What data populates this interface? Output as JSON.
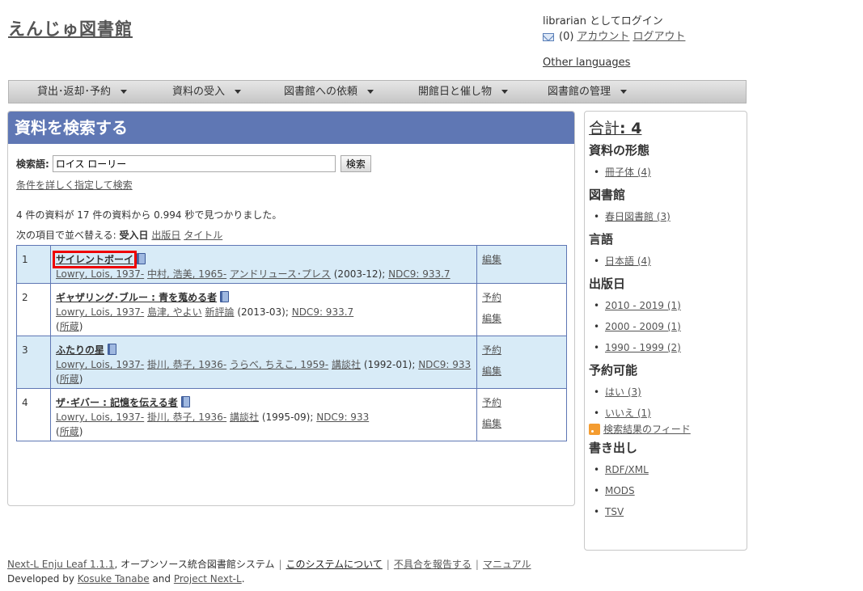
{
  "site": {
    "title": "えんじゅ図書館"
  },
  "user": {
    "login_text": "librarian としてログイン",
    "message_count": "(0)",
    "account_label": "アカウント",
    "logout_label": "ログアウト",
    "other_languages": "Other languages"
  },
  "nav": [
    {
      "label": "貸出･返却･予約"
    },
    {
      "label": "資料の受入"
    },
    {
      "label": "図書館への依頼"
    },
    {
      "label": "開館日と催し物"
    },
    {
      "label": "図書館の管理"
    }
  ],
  "main": {
    "heading": "資料を検索する",
    "search_label": "検索語:",
    "search_value": "ロイス ローリー",
    "search_button": "検索",
    "advanced_link": "条件を詳しく指定して検索",
    "summary": "4 件の資料が 17 件の資料から 0.994 秒で見つかりました。",
    "sort_label": "次の項目で並べ替える:",
    "sort_current": "受入日",
    "sort_pubdate": "出版日",
    "sort_title": "タイトル"
  },
  "results": [
    {
      "no": "1",
      "title": "サイレントボーイ",
      "author": "Lowry, Lois, 1937-",
      "others": [
        "中村, 浩美, 1965-"
      ],
      "publisher": "アンドリュース･プレス",
      "date": "(2003-12)",
      "ndc": "NDC9: 933.7",
      "holding": "",
      "actions": [
        "編集"
      ]
    },
    {
      "no": "2",
      "title": "ギャザリング･ブルー : 青を蒐める者",
      "author": "Lowry, Lois, 1937-",
      "others": [
        "島津, やよい"
      ],
      "publisher": "新評論",
      "date": "(2013-03)",
      "ndc": "NDC9: 933.7",
      "holding": "所蔵",
      "actions": [
        "予約",
        "編集"
      ]
    },
    {
      "no": "3",
      "title": "ふたりの星",
      "author": "Lowry, Lois, 1937-",
      "others": [
        "掛川, 恭子, 1936-",
        "うらべ, ちえこ, 1959-"
      ],
      "publisher": "講談社",
      "date": "(1992-01)",
      "ndc": "NDC9: 933",
      "holding": "所蔵",
      "actions": [
        "予約",
        "編集"
      ]
    },
    {
      "no": "4",
      "title": "ザ･ギバー : 記憶を伝える者",
      "author": "Lowry, Lois, 1937-",
      "others": [
        "掛川, 恭子, 1936-"
      ],
      "publisher": "講談社",
      "date": "(1995-09)",
      "ndc": "NDC9: 933",
      "holding": "所蔵",
      "actions": [
        "予約",
        "編集"
      ]
    }
  ],
  "side": {
    "total_label": "合計",
    "total_value": ": 4",
    "facets": [
      {
        "heading": "資料の形態",
        "items": [
          "冊子体 (4)"
        ]
      },
      {
        "heading": "図書館",
        "items": [
          "春日図書館 (3)"
        ]
      },
      {
        "heading": "言語",
        "items": [
          "日本語 (4)"
        ]
      },
      {
        "heading": "出版日",
        "items": [
          "2010 - 2019 (1)",
          "2000 - 2009 (1)",
          "1990 - 1999 (2)"
        ]
      },
      {
        "heading": "予約可能",
        "items": [
          "はい (3)",
          "いいえ (1)"
        ]
      }
    ],
    "feed_label": "検索結果のフィード",
    "export_heading": "書き出し",
    "exports": [
      "RDF/XML",
      "MODS",
      "TSV"
    ]
  },
  "footer": {
    "product": "Next-L Enju Leaf 1.1.1",
    "desc": ", オープンソース統合図書館システム",
    "about": "このシステムについて",
    "report": "不具合を報告する",
    "manual": "マニュアル",
    "developed_by": "Developed by",
    "dev_name": "Kosuke Tanabe",
    "and": "and",
    "project": "Project Next-L",
    "period": "."
  }
}
